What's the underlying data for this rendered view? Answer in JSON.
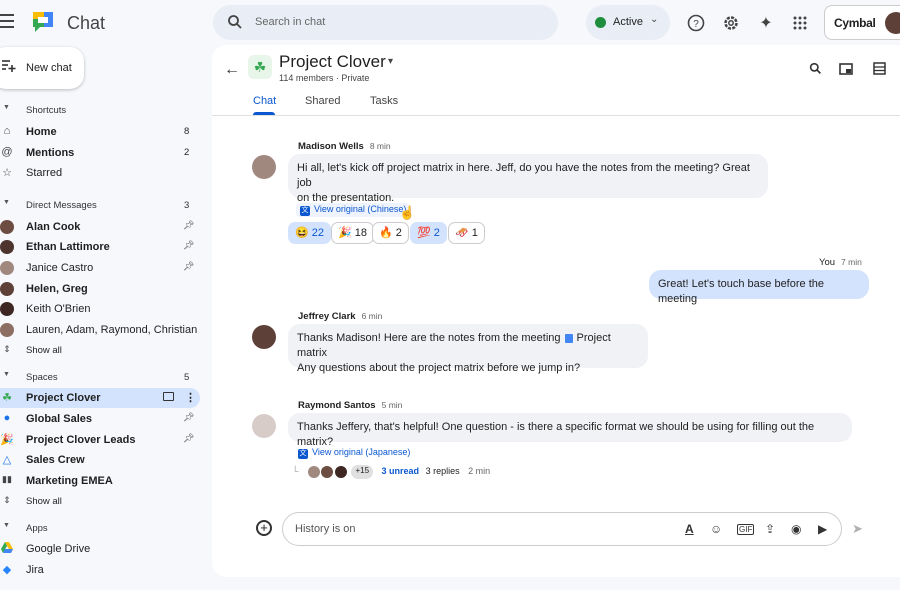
{
  "app": {
    "title": "Chat"
  },
  "search": {
    "placeholder": "Search in chat"
  },
  "status": {
    "label": "Active",
    "color": "#1e8e3e"
  },
  "brand": {
    "name": "Cymbal"
  },
  "sidebar": {
    "new_chat": "New chat",
    "shortcuts": {
      "header": "Shortcuts",
      "items": [
        {
          "label": "Home",
          "count": "8",
          "icon": "home-icon",
          "bold": true
        },
        {
          "label": "Mentions",
          "count": "2",
          "icon": "at-icon",
          "bold": true
        },
        {
          "label": "Starred",
          "count": "",
          "icon": "star-icon",
          "bold": false
        }
      ]
    },
    "direct_messages": {
      "header": "Direct Messages",
      "count": "3",
      "items": [
        {
          "label": "Alan Cook",
          "bold": true,
          "pinned": true
        },
        {
          "label": "Ethan Lattimore",
          "bold": true,
          "pinned": true
        },
        {
          "label": "Janice Castro",
          "bold": false,
          "pinned": true
        },
        {
          "label": "Helen, Greg",
          "bold": true,
          "pinned": false
        },
        {
          "label": "Keith O'Brien",
          "bold": false,
          "pinned": false
        },
        {
          "label": "Lauren, Adam, Raymond, Christian",
          "bold": false,
          "pinned": false
        }
      ],
      "show_all": "Show all"
    },
    "spaces": {
      "header": "Spaces",
      "count": "5",
      "items": [
        {
          "label": "Project Clover",
          "bold": true,
          "selected": true
        },
        {
          "label": "Global Sales",
          "bold": true,
          "pinned": true
        },
        {
          "label": "Project Clover Leads",
          "bold": true,
          "pinned": true
        },
        {
          "label": "Sales Crew",
          "bold": true
        },
        {
          "label": "Marketing EMEA",
          "bold": true
        }
      ],
      "show_all": "Show all"
    },
    "apps": {
      "header": "Apps",
      "items": [
        {
          "label": "Google Drive"
        },
        {
          "label": "Jira"
        }
      ]
    }
  },
  "space": {
    "name": "Project Clover",
    "subtitle": "114 members · Private",
    "tabs": [
      "Chat",
      "Shared",
      "Tasks"
    ]
  },
  "messages": [
    {
      "sender": "Madison Wells",
      "time": "8 min",
      "lines": [
        "Hi all, let's kick off project matrix in here. Jeff, do you have the notes from the meeting? Great job",
        "on the presentation."
      ],
      "view_original": "View original (Chinese)",
      "reactions": [
        {
          "emoji": "😆",
          "count": "22",
          "selected": true
        },
        {
          "emoji": "🎉",
          "count": "18",
          "selected": false
        },
        {
          "emoji": "🔥",
          "count": "2",
          "selected": false
        },
        {
          "emoji": "💯",
          "count": "2",
          "selected": true
        },
        {
          "emoji": "🛷",
          "count": "1",
          "selected": false
        }
      ]
    },
    {
      "sender": "You",
      "time": "7 min",
      "text": "Great! Let's touch base before the meeting"
    },
    {
      "sender": "Jeffrey Clark",
      "time": "6 min",
      "line1": "Thanks Madison!  Here are the notes from the meeting",
      "file": "Project matrix",
      "line2": "Any questions about the project matrix before we jump in?"
    },
    {
      "sender": "Raymond Santos",
      "time": "5 min",
      "text": "Thanks Jeffery, that's helpful!  One question -  is there a specific format we should be using for filling out the matrix?",
      "view_original": "View original (Japanese)",
      "thread": {
        "more": "+15",
        "unread": "3 unread",
        "replies": "3 replies",
        "time": "2 min"
      }
    }
  ],
  "composer": {
    "placeholder": "History is on"
  }
}
